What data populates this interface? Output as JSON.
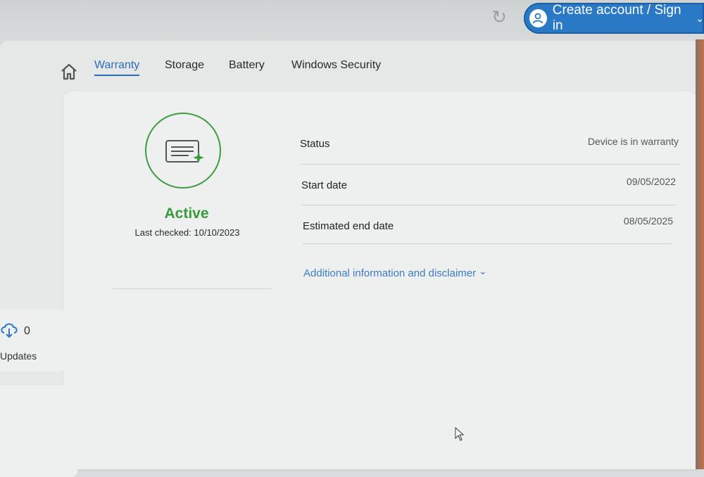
{
  "header": {
    "account_button_label": "Create account / Sign in",
    "refresh_icon": "refresh-icon",
    "account_icon": "user-icon"
  },
  "tabs": [
    {
      "label": "Warranty",
      "active": true
    },
    {
      "label": "Storage",
      "active": false
    },
    {
      "label": "Battery",
      "active": false
    },
    {
      "label": "Windows Security",
      "active": false
    }
  ],
  "warranty": {
    "state": "Active",
    "last_checked": "Last checked: 10/10/2023",
    "rows": [
      {
        "label": "Status",
        "value": "Device is in warranty"
      },
      {
        "label": "Start date",
        "value": "09/05/2022"
      },
      {
        "label": "Estimated end date",
        "value": "08/05/2025"
      }
    ],
    "more_link": "Additional information and disclaimer"
  },
  "sidebar": {
    "updates_count": "0",
    "updates_label": "Updates"
  },
  "colors": {
    "accent": "#2a79c6",
    "active_green": "#3a9a3a",
    "link": "#3b7cc0"
  }
}
